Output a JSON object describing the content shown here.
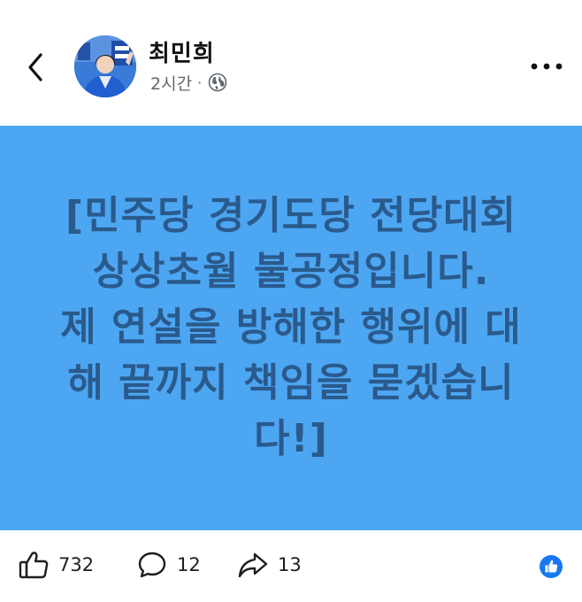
{
  "header": {
    "author_name": "최민희",
    "post_time": "2시간",
    "separator": "·",
    "privacy_icon": "globe-icon",
    "more_icon": "more-horizontal-icon",
    "back_icon": "chevron-left-icon"
  },
  "post": {
    "background_color": "#4da6f2",
    "text_color": "#2a5a8c",
    "lines": [
      "[민주당 경기도당 전당대회",
      "상상초월 불공정입니다.",
      "제 연설을 방해한 행위에 대",
      "해 끝까지 책임을 묻겠습니",
      "다!]"
    ]
  },
  "footer": {
    "like_count": "732",
    "comment_count": "12",
    "share_count": "13",
    "like_icon": "thumbs-up-icon",
    "comment_icon": "comment-bubble-icon",
    "share_icon": "share-arrow-icon",
    "reaction_icon": "like-reaction-badge-icon",
    "reaction_color": "#1877f2"
  }
}
